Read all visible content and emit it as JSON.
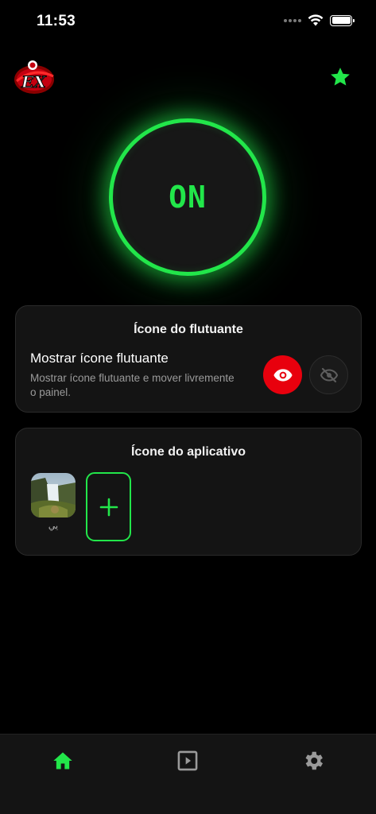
{
  "status_bar": {
    "time": "11:53"
  },
  "power": {
    "label": "ON"
  },
  "floating_card": {
    "title": "Ícone do flutuante",
    "setting_title": "Mostrar ícone flutuante",
    "setting_description": "Mostrar ícone flutuante e mover livremente o painel."
  },
  "app_icon_card": {
    "title": "Ícone do aplicativo",
    "options": [
      {
        "label": "يي"
      }
    ]
  },
  "icons": {
    "logo": "ex-logo",
    "favorite": "star-icon",
    "show": "eye-icon",
    "hide": "eye-off-icon",
    "add": "plus-icon",
    "nav": [
      "home-icon",
      "play-box-icon",
      "gear-icon"
    ]
  },
  "colors": {
    "accent": "#22e64a",
    "danger": "#e8000d",
    "background": "#000000",
    "card": "#141414"
  }
}
